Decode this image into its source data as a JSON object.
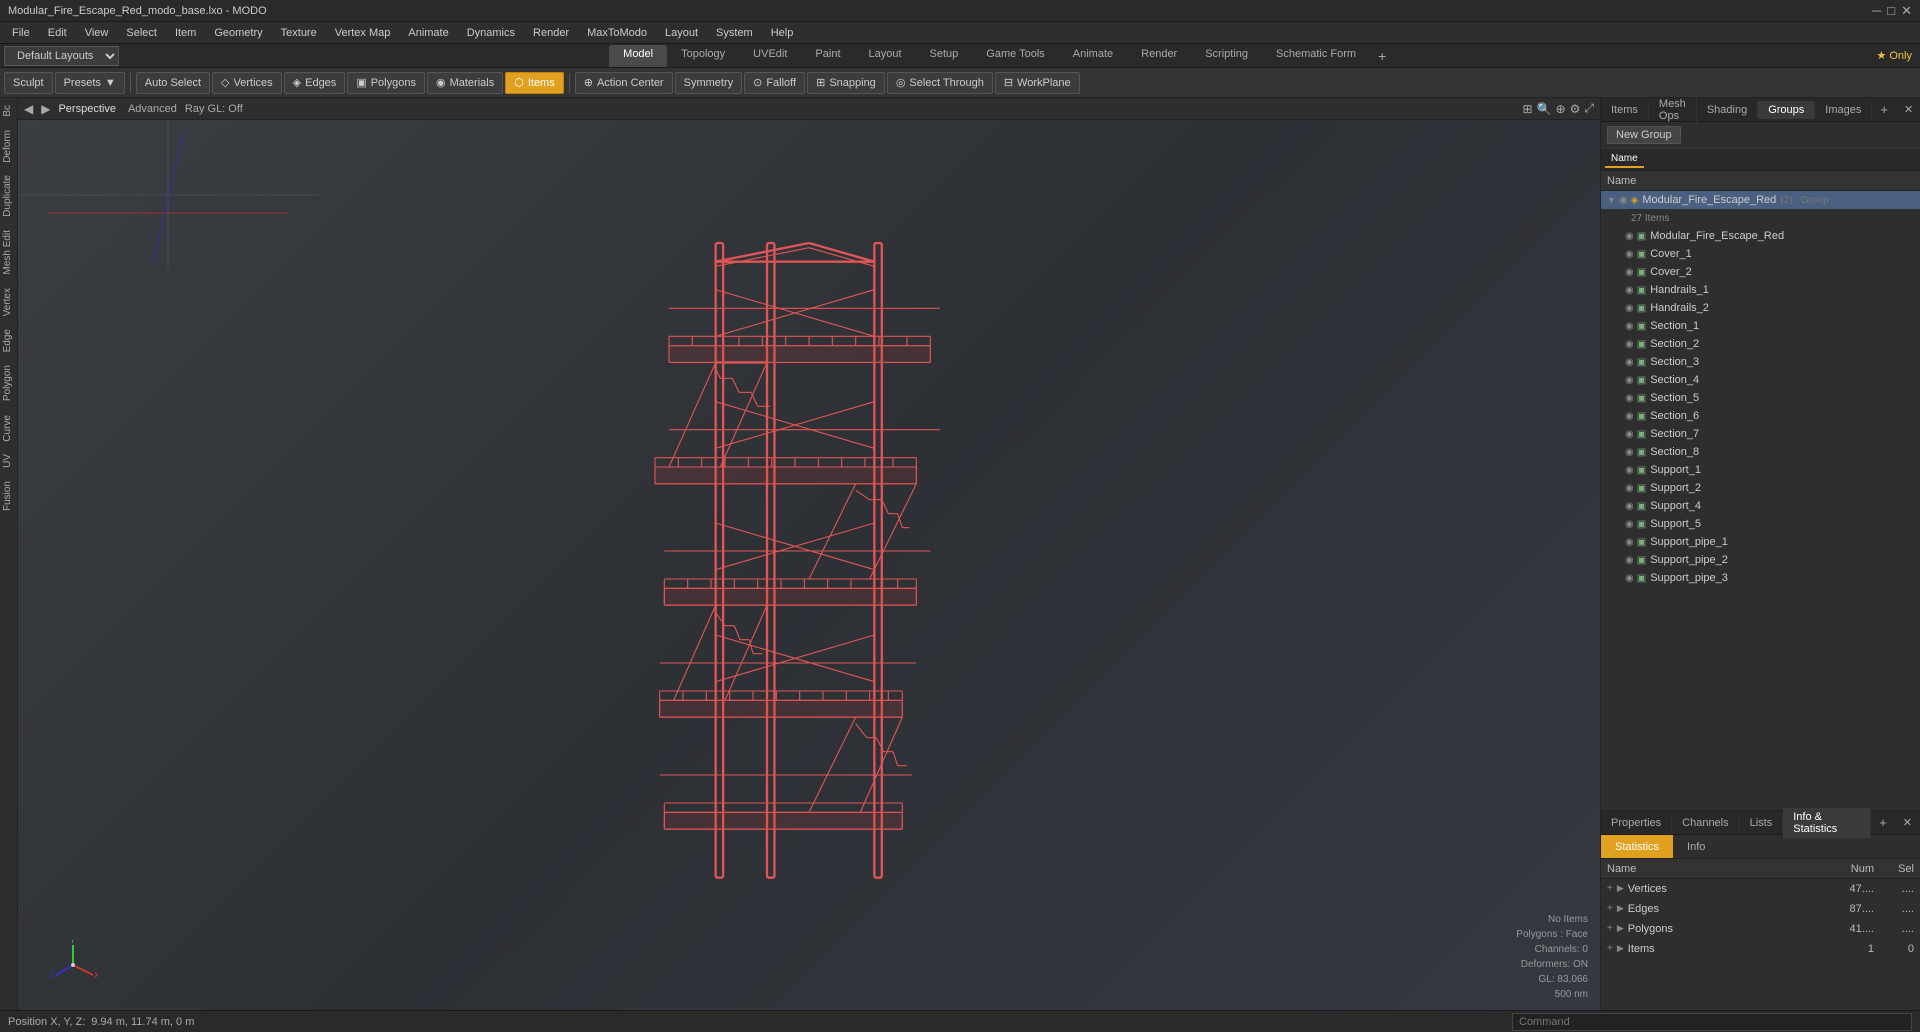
{
  "titleBar": {
    "title": "Modular_Fire_Escape_Red_modo_base.lxo - MODO",
    "controls": [
      "─",
      "□",
      "✕"
    ]
  },
  "menuBar": {
    "items": [
      "File",
      "Edit",
      "View",
      "Select",
      "Item",
      "Geometry",
      "Texture",
      "Vertex Map",
      "Animate",
      "Dynamics",
      "Render",
      "MaxToModo",
      "Layout",
      "System",
      "Help"
    ]
  },
  "layoutTabs": {
    "selector_label": "Default Layouts",
    "tabs": [
      {
        "label": "Model",
        "active": true
      },
      {
        "label": "Topology"
      },
      {
        "label": "UVEdit"
      },
      {
        "label": "Paint"
      },
      {
        "label": "Layout"
      },
      {
        "label": "Setup"
      },
      {
        "label": "Game Tools"
      },
      {
        "label": "Animate"
      },
      {
        "label": "Render"
      },
      {
        "label": "Scripting"
      },
      {
        "label": "Schematic Form"
      }
    ],
    "add_label": "+",
    "star_only": "★  Only"
  },
  "toolbar": {
    "sculpt_label": "Sculpt",
    "presets_label": "Presets",
    "presets_toggle": "▼",
    "auto_select_label": "Auto Select",
    "vertices_label": "Vertices",
    "edges_label": "Edges",
    "polygons_label": "Polygons",
    "materials_label": "Materials",
    "items_label": "Items",
    "action_center_label": "Action Center",
    "symmetry_label": "Symmetry",
    "falloff_label": "Falloff",
    "snapping_label": "Snapping",
    "select_through_label": "Select Through",
    "workplane_label": "WorkPlane"
  },
  "leftSidebar": {
    "tabs": [
      "Bc",
      "Deform",
      "Duplicate",
      "Mesh Edit",
      "Vertex",
      "Edge",
      "Polygon",
      "Curve",
      "UV",
      "Fusion"
    ]
  },
  "viewport": {
    "nav_prev": "◀",
    "nav_next": "▶",
    "view_name": "Perspective",
    "options": [
      "Advanced",
      "Ray GL: Off"
    ],
    "icons": [
      "⊕",
      "🔍",
      "⚙"
    ],
    "info_overlay": {
      "no_items": "No Items",
      "polygons_face": "Polygons : Face",
      "channels": "Channels: 0",
      "deformers": "Deformers: ON",
      "gl": "GL: 83,066",
      "size": "500 nm"
    }
  },
  "statusBar": {
    "position_label": "Position X, Y, Z:",
    "position_value": "9.94 m, 11.74 m, 0 m",
    "command_placeholder": "Command"
  },
  "rightPanel": {
    "tabs": [
      "Items",
      "Mesh Ops",
      "Shading",
      "Groups",
      "Images"
    ],
    "active_tab": "Groups",
    "add_tab": "+",
    "groups": {
      "new_group_label": "New Group",
      "sub_tabs": [
        "Name"
      ],
      "column_name": "Name",
      "root_item": {
        "label": "Modular_Fire_Escape_Red",
        "suffix": "(2) : Group",
        "count": "27 Items",
        "children": [
          "Modular_Fire_Escape_Red",
          "Cover_1",
          "Cover_2",
          "Handrails_1",
          "Handrails_2",
          "Section_1",
          "Section_2",
          "Section_3",
          "Section_4",
          "Section_5",
          "Section_6",
          "Section_7",
          "Section_8",
          "Support_1",
          "Support_2",
          "Support_4",
          "Support_5",
          "Support_pipe_1",
          "Support_pipe_2",
          "Support_pipe_3"
        ]
      }
    }
  },
  "bottomRightPanel": {
    "tabs": [
      "Properties",
      "Channels",
      "Lists",
      "Info & Statistics"
    ],
    "active_tab": "Info & Statistics",
    "add_tab": "+",
    "stats": {
      "stats_tab": "Statistics",
      "info_tab": "Info",
      "columns": {
        "name": "Name",
        "num": "Num",
        "sel": "Sel"
      },
      "rows": [
        {
          "name": "Vertices",
          "num": "47....",
          "sel": "...."
        },
        {
          "name": "Edges",
          "num": "87....",
          "sel": "...."
        },
        {
          "name": "Polygons",
          "num": "41....",
          "sel": "...."
        },
        {
          "name": "Items",
          "num": "1",
          "sel": "0"
        }
      ]
    }
  },
  "colors": {
    "accent": "#e0a020",
    "active_tab_bg": "#4a4a4a",
    "model_color": "#e05050"
  }
}
